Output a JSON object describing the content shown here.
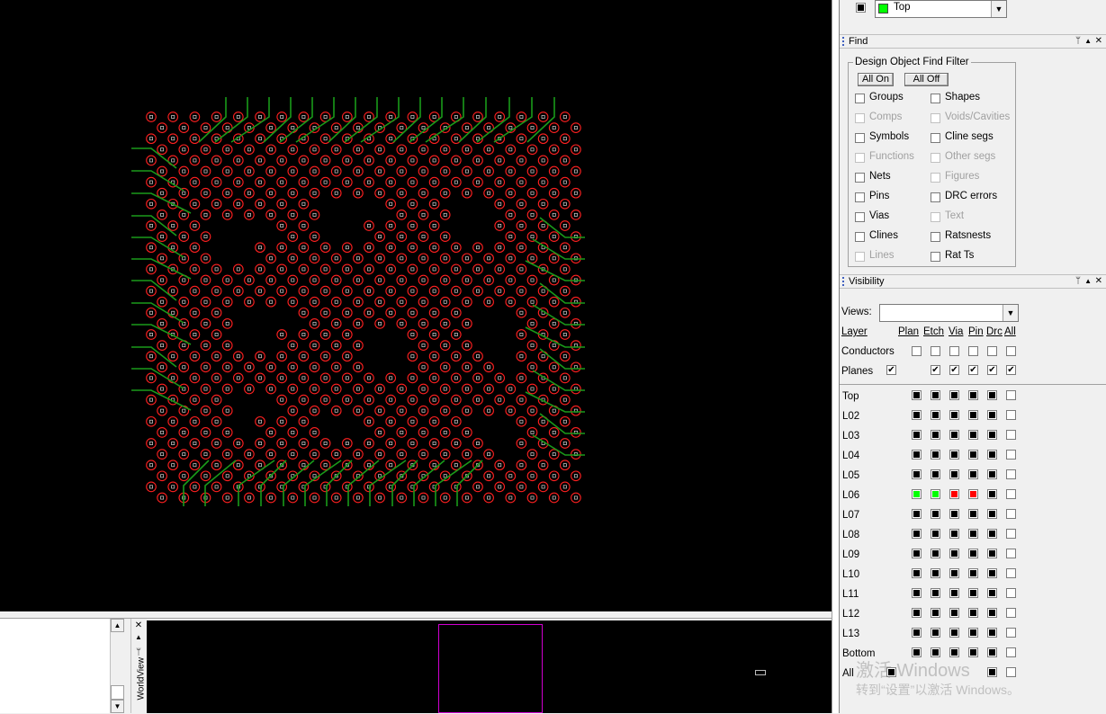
{
  "layer_selector": {
    "value": "Top",
    "color": "#00ff00"
  },
  "find": {
    "title": "Find",
    "filter_title": "Design Object Find Filter",
    "all_on": "All On",
    "all_off": "All Off",
    "items_left": [
      {
        "label": "Groups",
        "enabled": true
      },
      {
        "label": "Comps",
        "enabled": false
      },
      {
        "label": "Symbols",
        "enabled": true
      },
      {
        "label": "Functions",
        "enabled": false
      },
      {
        "label": "Nets",
        "enabled": true
      },
      {
        "label": "Pins",
        "enabled": true
      },
      {
        "label": "Vias",
        "enabled": true
      },
      {
        "label": "Clines",
        "enabled": true
      },
      {
        "label": "Lines",
        "enabled": false
      }
    ],
    "items_right": [
      {
        "label": "Shapes",
        "enabled": true
      },
      {
        "label": "Voids/Cavities",
        "enabled": false
      },
      {
        "label": "Cline segs",
        "enabled": true
      },
      {
        "label": "Other segs",
        "enabled": false
      },
      {
        "label": "Figures",
        "enabled": false
      },
      {
        "label": "DRC errors",
        "enabled": true
      },
      {
        "label": "Text",
        "enabled": false
      },
      {
        "label": "Ratsnests",
        "enabled": true
      },
      {
        "label": "Rat Ts",
        "enabled": true
      }
    ]
  },
  "visibility": {
    "title": "Visibility",
    "views_label": "Views:",
    "views_value": "",
    "layer_header": "Layer",
    "columns": [
      "Plan",
      "Etch",
      "Via",
      "Pin",
      "Drc",
      "All"
    ],
    "conductors_label": "Conductors",
    "planes_label": "Planes",
    "layers": [
      "Top",
      "L02",
      "L03",
      "L04",
      "L05",
      "L06",
      "L07",
      "L08",
      "L09",
      "L10",
      "L11",
      "L12",
      "L13",
      "Bottom",
      "All"
    ]
  },
  "worldview": {
    "label": "WorldView"
  },
  "watermark": {
    "line1": "激活 Windows",
    "line2": "转到“设置”以激活 Windows。"
  },
  "colors": {
    "pad": "#ff2020",
    "trace": "#1a9a1a",
    "canvas_bg": "#000000",
    "frame": "#d000d0"
  }
}
